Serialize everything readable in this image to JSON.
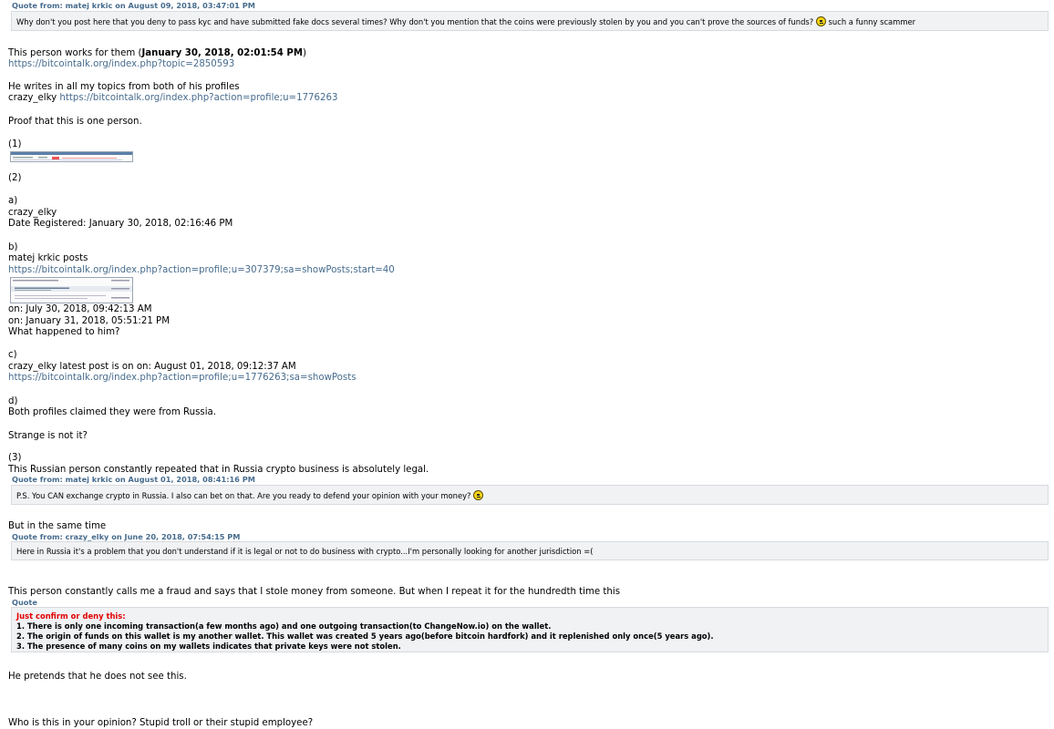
{
  "quote1": {
    "header": "Quote from: matej krkic on August 09, 2018, 03:47:01 PM",
    "text": "Why don't you post here that you deny to pass kyc and have submitted fake docs several times? Why don't you mention that the coins were previously  stolen by you and you can't prove the sources of funds?",
    "suffix": " such a funny scammer",
    "icon": "smiley-icon"
  },
  "p1": {
    "text": "This person works for them (",
    "date": "January 30, 2018, 02:01:54 PM",
    "close": ")",
    "link": "https://bitcointalk.org/index.php?topic=2850593"
  },
  "p2": {
    "line1": "He writes in all my topics from both of his profiles",
    "name": "crazy_elky ",
    "link": "https://bitcointalk.org/index.php?action=profile;u=1776263"
  },
  "p3": "Proof that this is one person.",
  "m1": "(1)",
  "m2": "(2)",
  "a": {
    "label": "a)",
    "name": "crazy_elky",
    "registered": "Date Registered:   January 30, 2018, 02:16:46 PM"
  },
  "b": {
    "label": "b)",
    "name": "matej krkic posts",
    "link": "https://bitcointalk.org/index.php?action=profile;u=307379;sa=showPosts;start=40",
    "on1": "on: July 30, 2018, 09:42:13 AM",
    "on2": "on: January 31, 2018, 05:51:21 PM",
    "q": "What happened to him?"
  },
  "c": {
    "label": "c)",
    "text": "crazy_elky latest post is on on: August 01, 2018, 09:12:37 AM",
    "link": "https://bitcointalk.org/index.php?action=profile;u=1776263;sa=showPosts"
  },
  "d": {
    "label": "d)",
    "text": "Both profiles claimed they were from Russia."
  },
  "strange": "Strange is not it?",
  "m3": "(3)",
  "russian": "This Russian person constantly repeated that in Russia crypto business is absolutely legal.",
  "quote2": {
    "header": "Quote from: matej krkic on August 01, 2018, 08:41:16 PM",
    "text": "P.S. You CAN exchange crypto in Russia. I also can bet on that. Are you ready to defend your opinion with your money?",
    "icon": "smiley-icon"
  },
  "same_time": "But in the same time",
  "quote3": {
    "header": "Quote from: crazy_elky on June 20, 2018, 07:54:15 PM",
    "text": "Here in Russia it's a problem that you don't understand if it is legal or not to do business with crypto...I'm personally looking for another jurisdiction =("
  },
  "fraud": "This person constantly calls me a fraud and says that I stole money from someone. But when I repeat it for the hundredth time this",
  "quote4": {
    "header": "Quote",
    "title": "Just confirm or deny this:",
    "items": [
      "1. There is only one incoming transaction(a few months ago) and one outgoing transaction(to ChangeNow.io) on the wallet.",
      "2. The origin of funds on this wallet is my another wallet. This wallet was created 5 years ago(before bitcoin hardfork) and it replenished only once(5 years ago).",
      "3. The presence of many coins on my wallets indicates that private keys were not stolen."
    ]
  },
  "pretends": "He pretends that he does not see this.",
  "who": "Who is this in your opinion? Stupid troll or their stupid employee?"
}
